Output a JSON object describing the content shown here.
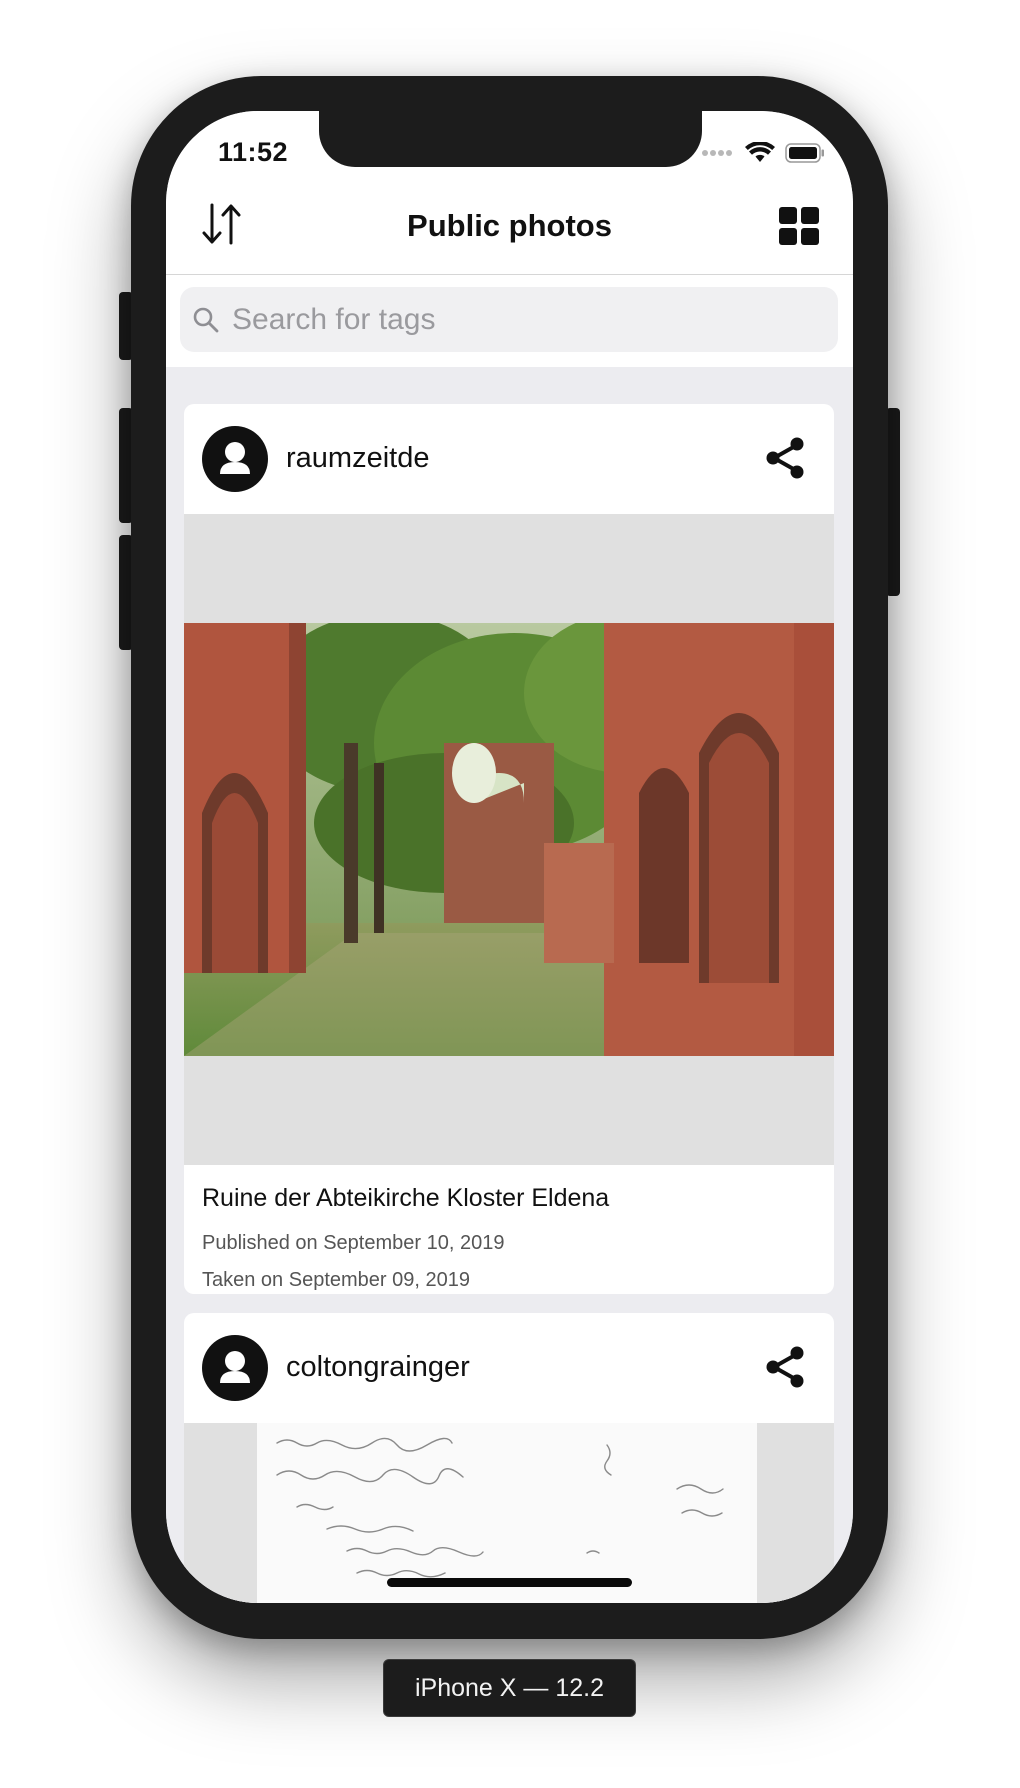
{
  "status_bar": {
    "time": "11:52"
  },
  "nav": {
    "title": "Public photos",
    "left_icon": "sort-icon",
    "right_icon": "grid-view-icon"
  },
  "search": {
    "placeholder": "Search for tags",
    "value": ""
  },
  "posts": [
    {
      "username": "raumzeitde",
      "title": "Ruine der Abteikirche Kloster Eldena",
      "published": "Published on September 10, 2019",
      "taken": "Taken on September 09, 2019"
    },
    {
      "username": "coltongrainger"
    }
  ],
  "device_label": "iPhone X — 12.2",
  "colors": {
    "background": "#ececf0",
    "card": "#ffffff",
    "frame": "#1c1c1c",
    "placeholder_gray": "#e0e0e0"
  }
}
